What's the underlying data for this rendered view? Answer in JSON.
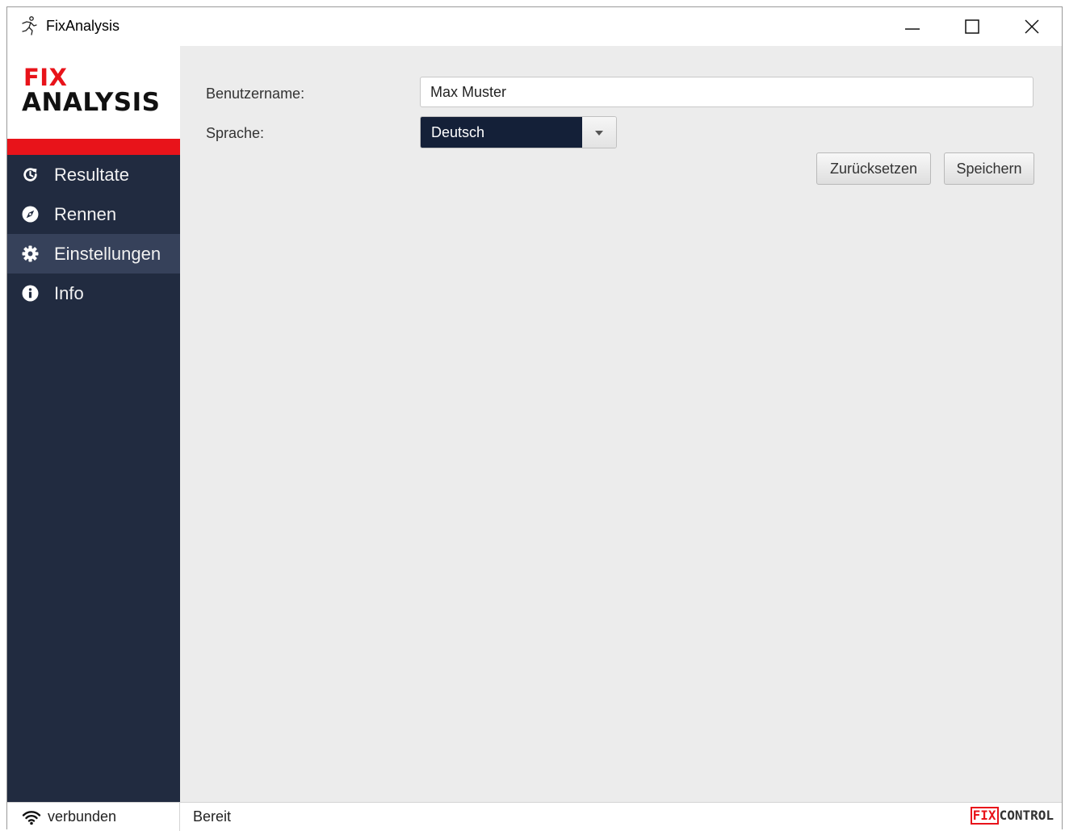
{
  "window": {
    "title": "FixAnalysis",
    "controls": {
      "minimize": "minimize-icon",
      "maximize": "maximize-icon",
      "close": "close-icon"
    }
  },
  "sidebar": {
    "logo": {
      "line1": "FIX",
      "line2": "ANALYSIS"
    },
    "items": [
      {
        "label": "Resultate",
        "icon": "history-icon",
        "active": false
      },
      {
        "label": "Rennen",
        "icon": "compass-icon",
        "active": false
      },
      {
        "label": "Einstellungen",
        "icon": "gear-icon",
        "active": true
      },
      {
        "label": "Info",
        "icon": "info-icon",
        "active": false
      }
    ]
  },
  "settings": {
    "username_label": "Benutzername:",
    "username_value": "Max Muster",
    "language_label": "Sprache:",
    "language_value": "Deutsch",
    "reset_label": "Zurücksetzen",
    "save_label": "Speichern"
  },
  "statusbar": {
    "connection": "verbunden",
    "status": "Bereit",
    "brand_fix": "FIX",
    "brand_control": "CONTROL"
  },
  "colors": {
    "sidebar_bg": "#212b40",
    "sidebar_active": "#36415a",
    "accent_red": "#e8131a",
    "select_bg": "#142038",
    "content_bg": "#ececec"
  }
}
